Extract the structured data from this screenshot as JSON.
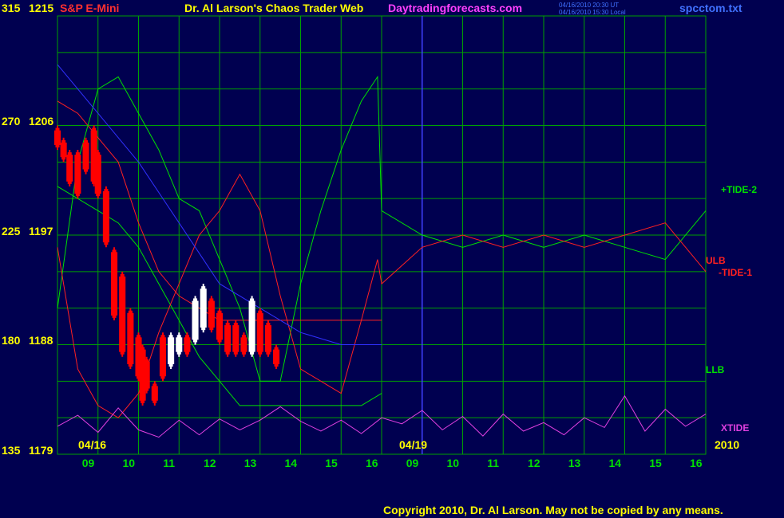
{
  "header": {
    "instrument": "S&P E-Mini",
    "title": "Dr. Al Larson's Chaos Trader Web",
    "website": "Daytradingforecasts.com",
    "time_ut": "04/16/2010 20:30 UT",
    "time_local": "04/16/2010 15:30 Local",
    "filename": "spcctom.txt"
  },
  "footer": {
    "copyright": "Copyright 2010, Dr. Al Larson. May not be copied by any means."
  },
  "colors": {
    "background": "#000050",
    "grid": "#00a000",
    "price_down": "#ff0000",
    "price_up": "#ffffff",
    "tide1": "#ff2020",
    "tide2": "#00e000",
    "xtide": "#e040e0",
    "blue_line": "#3030ff",
    "forecast_divider": "#4040ff",
    "label_yellow": "#ffff00"
  },
  "chart_data": {
    "type": "line",
    "title": "S&P E-Mini",
    "y_left_ticks": [
      "315",
      "270",
      "225",
      "180",
      "135"
    ],
    "y_right_ticks": [
      "1215",
      "1206",
      "1197",
      "1188",
      "1179"
    ],
    "ylim": [
      1179,
      1215
    ],
    "x_hour_ticks": [
      "09",
      "10",
      "11",
      "12",
      "13",
      "14",
      "15",
      "16",
      "09",
      "10",
      "11",
      "12",
      "13",
      "14",
      "15",
      "16"
    ],
    "date_labels": [
      "04/16",
      "04/19"
    ],
    "year_label": "2010",
    "forecast_start_index": 8,
    "price_bars": {
      "x": [
        0,
        0.15,
        0.3,
        0.5,
        0.7,
        0.9,
        1.0,
        1.2,
        1.4,
        1.6,
        1.8,
        2.0,
        2.1,
        2.2,
        2.4,
        2.6,
        2.8,
        3.0,
        3.2,
        3.4,
        3.6,
        3.8,
        4.0,
        4.2,
        4.4,
        4.6,
        4.8,
        5.0,
        5.2,
        5.4,
        5.6,
        5.8,
        6.0,
        6.2,
        6.4,
        6.6,
        6.8,
        7.0,
        7.2,
        7.4,
        7.6,
        7.8,
        8.0
      ],
      "high": [
        1206,
        1205,
        1204,
        1204,
        1205,
        1206,
        1204,
        1201,
        1196,
        1194,
        1191,
        1189,
        1188,
        1187,
        1185,
        1189,
        1189,
        1189,
        1189,
        1192,
        1193,
        1192,
        1191,
        1190,
        1190,
        1189,
        1192,
        1191,
        1190,
        1188
      ],
      "low": [
        1204,
        1203,
        1201,
        1200,
        1202,
        1201,
        1200,
        1196,
        1190,
        1187,
        1186,
        1185,
        1183,
        1184,
        1183,
        1185,
        1186,
        1187,
        1187,
        1188,
        1189,
        1189,
        1188,
        1187,
        1187,
        1187,
        1187,
        1187,
        1187,
        1186
      ]
    },
    "series": [
      {
        "name": "ULB",
        "color": "#ff2020",
        "x": [
          0,
          0.5,
          1,
          1.5,
          2,
          2.5,
          3,
          3.5,
          4,
          4.5,
          5,
          5.5,
          6,
          6.5,
          7,
          7.5,
          8
        ],
        "y": [
          1208,
          1207,
          1205,
          1203,
          1198,
          1194,
          1192,
          1191,
          1190,
          1190,
          1190,
          1190,
          1190,
          1190,
          1190,
          1190,
          1190
        ]
      },
      {
        "name": "LLB",
        "color": "#00e000",
        "x": [
          0,
          0.5,
          1,
          1.5,
          2,
          2.5,
          3,
          3.5,
          4,
          4.5,
          5,
          5.5,
          6,
          6.5,
          7,
          7.5,
          8
        ],
        "y": [
          1201,
          1200,
          1199,
          1198,
          1196,
          1193,
          1190,
          1187,
          1185,
          1183,
          1183,
          1183,
          1183,
          1183,
          1183,
          1183,
          1184
        ]
      },
      {
        "name": "+TIDE-2",
        "color": "#00e000",
        "x": [
          0,
          0.5,
          1,
          1.5,
          2,
          2.5,
          3,
          3.5,
          4,
          4.5,
          5,
          5.5,
          6,
          6.5,
          7,
          7.5,
          7.9,
          8,
          9,
          10,
          11,
          12,
          13,
          14,
          15,
          16
        ],
        "y": [
          1191,
          1203,
          1209,
          1210,
          1207,
          1204,
          1200,
          1199,
          1195,
          1191,
          1185,
          1185,
          1193,
          1199,
          1204,
          1208,
          1210,
          1199,
          1197,
          1196,
          1197,
          1196,
          1197,
          1196,
          1195,
          1199
        ]
      },
      {
        "name": "-TIDE-1",
        "color": "#ff2020",
        "x": [
          0,
          0.5,
          1,
          1.5,
          2,
          2.5,
          3,
          3.5,
          4,
          4.5,
          5,
          5.5,
          6,
          6.5,
          7,
          7.5,
          7.9,
          8,
          9,
          10,
          11,
          12,
          13,
          14,
          15,
          16
        ],
        "y": [
          1196,
          1186,
          1183,
          1182,
          1184,
          1189,
          1193,
          1197,
          1199,
          1202,
          1199,
          1192,
          1186,
          1185,
          1184,
          1190,
          1195,
          1193,
          1196,
          1197,
          1196,
          1197,
          1196,
          1197,
          1198,
          1194
        ]
      },
      {
        "name": "blue",
        "color": "#3030ff",
        "x": [
          0,
          1,
          2,
          3,
          4,
          5,
          6,
          7,
          8
        ],
        "y": [
          1211,
          1207,
          1203,
          1198,
          1193,
          1191,
          1189,
          1188,
          1188
        ]
      },
      {
        "name": "XTIDE",
        "color": "#e040e0",
        "x": [
          0,
          0.5,
          1,
          1.5,
          2,
          2.5,
          3,
          3.5,
          4,
          4.5,
          5,
          5.5,
          6,
          6.5,
          7,
          7.5,
          8,
          8.5,
          9,
          9.5,
          10,
          10.5,
          11,
          11.5,
          12,
          12.5,
          13,
          13.5,
          14,
          14.5,
          15,
          15.5,
          16
        ],
        "y": [
          1181.3,
          1182.2,
          1180.8,
          1182.8,
          1181.0,
          1180.4,
          1181.8,
          1180.6,
          1181.9,
          1181.0,
          1181.8,
          1182.9,
          1181.7,
          1180.9,
          1181.8,
          1180.7,
          1182.0,
          1181.5,
          1182.6,
          1181.0,
          1182.1,
          1180.5,
          1182.3,
          1180.9,
          1181.6,
          1180.6,
          1182.0,
          1181.2,
          1183.8,
          1180.9,
          1182.7,
          1181.3,
          1182.3
        ]
      }
    ],
    "right_labels": [
      "+TIDE-2",
      "ULB",
      "-TIDE-1",
      "LLB",
      "XTIDE"
    ]
  }
}
